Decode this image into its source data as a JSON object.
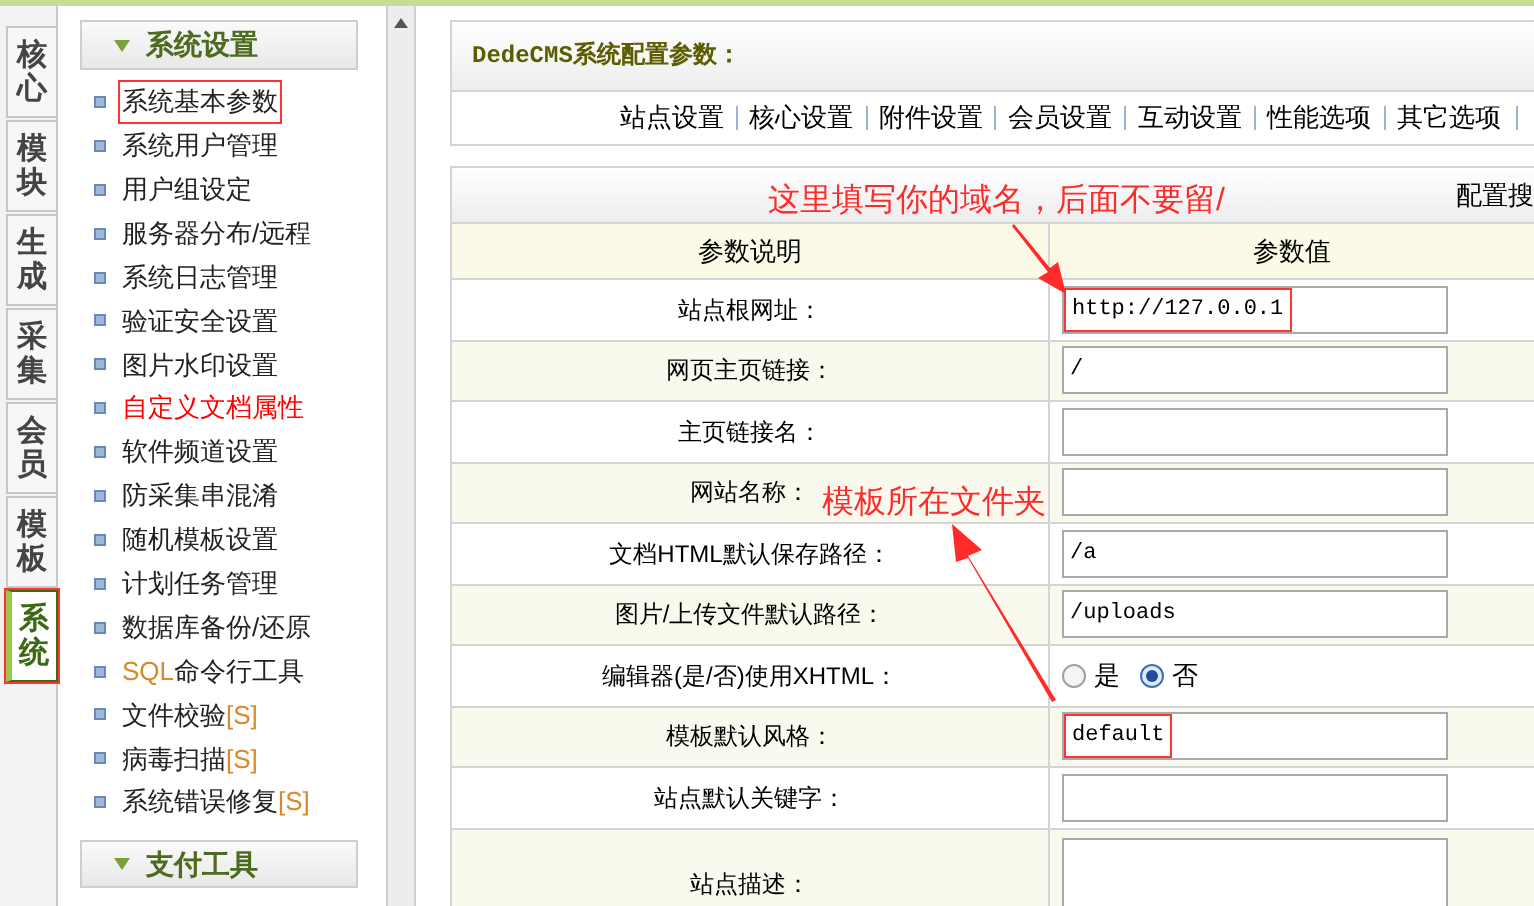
{
  "side_tabs": [
    {
      "label": "核心",
      "selected": false
    },
    {
      "label": "模块",
      "selected": false
    },
    {
      "label": "生成",
      "selected": false
    },
    {
      "label": "采集",
      "selected": false
    },
    {
      "label": "会员",
      "selected": false
    },
    {
      "label": "模板",
      "selected": false
    },
    {
      "label": "系统",
      "selected": true,
      "highlighted": true
    }
  ],
  "sidebar": {
    "section": "系统设置",
    "items": [
      {
        "label": "系统基本参数",
        "highlighted": true,
        "emphasized": false
      },
      {
        "label": "系统用户管理",
        "highlighted": false,
        "emphasized": false
      },
      {
        "label": "用户组设定",
        "highlighted": false,
        "emphasized": false
      },
      {
        "label": "服务器分布/远程",
        "highlighted": false,
        "emphasized": false
      },
      {
        "label": "系统日志管理",
        "highlighted": false,
        "emphasized": false
      },
      {
        "label": "验证安全设置",
        "highlighted": false,
        "emphasized": false
      },
      {
        "label": "图片水印设置",
        "highlighted": false,
        "emphasized": false
      },
      {
        "label": "自定义文档属性",
        "highlighted": false,
        "emphasized": true
      },
      {
        "label": "软件频道设置",
        "highlighted": false,
        "emphasized": false
      },
      {
        "label": "防采集串混淆",
        "highlighted": false,
        "emphasized": false
      },
      {
        "label": "随机模板设置",
        "highlighted": false,
        "emphasized": false
      },
      {
        "label": "计划任务管理",
        "highlighted": false,
        "emphasized": false
      },
      {
        "label": "数据库备份/还原",
        "highlighted": false,
        "emphasized": false
      },
      {
        "prefix": "SQL",
        "label": "命令行工具",
        "highlighted": false,
        "emphasized": false
      },
      {
        "label": "文件校验",
        "suffix": "[S]",
        "highlighted": false,
        "emphasized": false
      },
      {
        "label": "病毒扫描",
        "suffix": "[S]",
        "highlighted": false,
        "emphasized": false
      },
      {
        "label": "系统错误修复",
        "suffix": "[S]",
        "highlighted": false,
        "emphasized": false
      }
    ],
    "next_section": "支付工具"
  },
  "page_title": "DedeCMS系统配置参数：",
  "config_tabs": [
    "站点设置",
    "核心设置",
    "附件设置",
    "会员设置",
    "互动设置",
    "性能选项",
    "其它选项"
  ],
  "search_label": "配置搜",
  "table": {
    "columns": [
      "参数说明",
      "参数值"
    ],
    "rows": [
      {
        "kind": "text",
        "label": "站点根网址：",
        "value": "http://127.0.0.1",
        "highlighted": true
      },
      {
        "kind": "text",
        "label": "网页主页链接：",
        "value": "/",
        "highlighted": false
      },
      {
        "kind": "text",
        "label": "主页链接名："
      },
      {
        "kind": "text",
        "label": "网站名称："
      },
      {
        "kind": "text",
        "label": "文档HTML默认保存路径：",
        "value": "/a",
        "highlighted": false
      },
      {
        "kind": "text",
        "label": "图片/上传文件默认路径：",
        "value": "/uploads",
        "highlighted": false
      },
      {
        "kind": "radio",
        "label": "编辑器(是/否)使用XHTML：",
        "options": [
          {
            "label": "是",
            "selected": false
          },
          {
            "label": "否",
            "selected": true
          }
        ]
      },
      {
        "kind": "text",
        "label": "模板默认风格：",
        "value": "default",
        "highlighted": true
      },
      {
        "kind": "text",
        "label": "站点默认关键字："
      },
      {
        "kind": "textarea",
        "label": "站点描述："
      }
    ]
  },
  "annotations": [
    {
      "text": "这里填写你的域名，后面不要留/"
    },
    {
      "text": "模板所在文件夹"
    }
  ]
}
